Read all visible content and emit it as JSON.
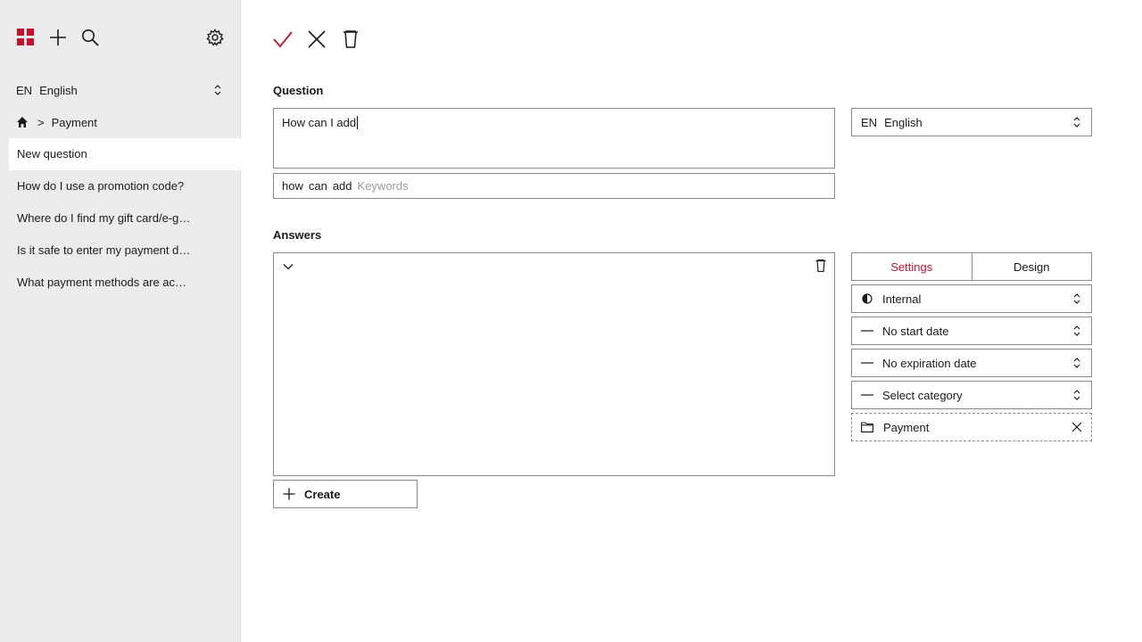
{
  "sidebar": {
    "language": {
      "code": "EN",
      "name": "English"
    },
    "breadcrumb": {
      "separator": ">",
      "current": "Payment"
    },
    "items": [
      {
        "label": "New question"
      },
      {
        "label": "How do I use a promotion code?"
      },
      {
        "label": "Where do I find my gift card/e-gift card balance?"
      },
      {
        "label": "Is it safe to enter my payment details?"
      },
      {
        "label": "What payment methods are accepted?"
      }
    ]
  },
  "main": {
    "question_label": "Question",
    "question_text": "How can I add",
    "keywords": [
      "how",
      "can",
      "add"
    ],
    "keywords_placeholder": "Keywords",
    "language": {
      "code": "EN",
      "name": "English"
    },
    "answers_label": "Answers",
    "create_label": "Create"
  },
  "settings": {
    "tabs": [
      {
        "label": "Settings"
      },
      {
        "label": "Design"
      }
    ],
    "visibility": "Internal",
    "start_date": "No start date",
    "expiration_date": "No expiration date",
    "category_placeholder": "Select category",
    "category": "Payment"
  },
  "colors": {
    "accent": "#c8102e",
    "sidebar_bg": "#ececec",
    "border": "#8a8a8a"
  },
  "icons": [
    "apps-grid-icon",
    "plus-icon",
    "search-icon",
    "gear-icon",
    "home-icon",
    "check-icon",
    "close-icon",
    "trash-icon",
    "chevron-down-icon",
    "half-circle-icon",
    "dash-icon",
    "folder-icon",
    "updown-icon"
  ]
}
